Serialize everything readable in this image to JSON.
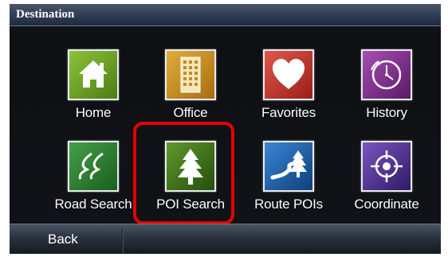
{
  "header": {
    "title": "Destination"
  },
  "tiles": [
    {
      "label": "Home",
      "icon": "home-icon",
      "color": "#6a9a1f"
    },
    {
      "label": "Office",
      "icon": "office-building-icon",
      "color": "#c9901a"
    },
    {
      "label": "Favorites",
      "icon": "heart-icon",
      "color": "#c0332b"
    },
    {
      "label": "History",
      "icon": "clock-icon",
      "color": "#7b2f86"
    },
    {
      "label": "Road Search",
      "icon": "road-icon",
      "color": "#2e7d32"
    },
    {
      "label": "POI Search",
      "icon": "pine-tree-icon",
      "color": "#3f7a1c"
    },
    {
      "label": "Route POIs",
      "icon": "route-tree-icon",
      "color": "#1f5fa8"
    },
    {
      "label": "Coordinate",
      "icon": "crosshair-icon",
      "color": "#5a3a9a"
    }
  ],
  "selected_tile": "POI Search",
  "footer": {
    "back_label": "Back"
  }
}
